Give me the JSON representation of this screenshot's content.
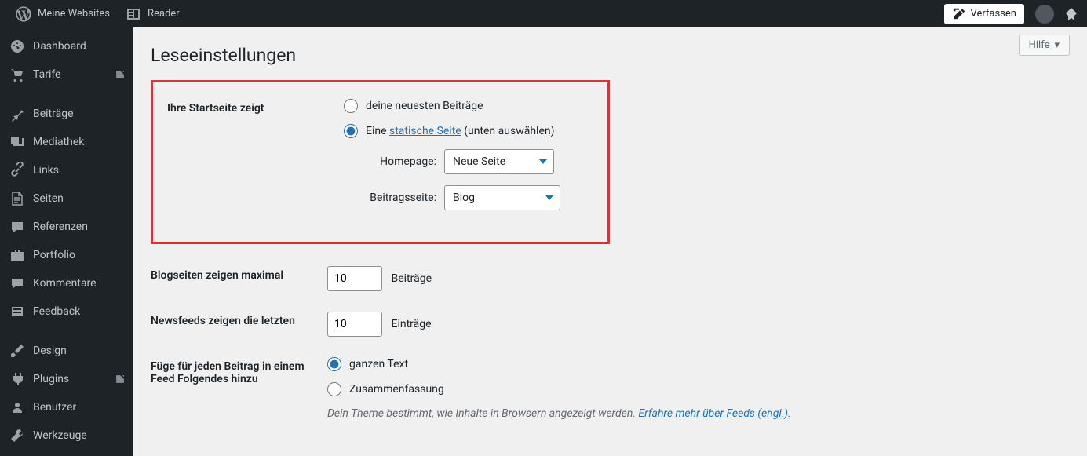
{
  "topbar": {
    "my_sites": "Meine Websites",
    "reader": "Reader",
    "compose": "Verfassen"
  },
  "sidebar": {
    "items": [
      {
        "label": "Dashboard",
        "icon": "dashboard"
      },
      {
        "label": "Tarife",
        "icon": "cart",
        "ext": true
      },
      {
        "label": "Beiträge",
        "icon": "pin"
      },
      {
        "label": "Mediathek",
        "icon": "media"
      },
      {
        "label": "Links",
        "icon": "link"
      },
      {
        "label": "Seiten",
        "icon": "page"
      },
      {
        "label": "Referenzen",
        "icon": "quote"
      },
      {
        "label": "Portfolio",
        "icon": "portfolio"
      },
      {
        "label": "Kommentare",
        "icon": "comment"
      },
      {
        "label": "Feedback",
        "icon": "feedback"
      },
      {
        "label": "Design",
        "icon": "brush"
      },
      {
        "label": "Plugins",
        "icon": "plugin",
        "ext": true
      },
      {
        "label": "Benutzer",
        "icon": "user"
      },
      {
        "label": "Werkzeuge",
        "icon": "tool"
      }
    ]
  },
  "help_tab": "Hilfe",
  "page_title": "Leseeinstellungen",
  "rows": {
    "front": {
      "label": "Ihre Startseite zeigt",
      "opt_latest": "deine neuesten Beiträge",
      "opt_static_pre": "Eine ",
      "opt_static_link": "statische Seite",
      "opt_static_post": " (unten auswählen)",
      "homepage_label": "Homepage:",
      "homepage_value": "Neue Seite",
      "posts_label": "Beitragsseite:",
      "posts_value": "Blog"
    },
    "blog_max": {
      "label": "Blogseiten zeigen maximal",
      "value": "10",
      "suffix": "Beiträge"
    },
    "feed_max": {
      "label": "Newsfeeds zeigen die letzten",
      "value": "10",
      "suffix": "Einträge"
    },
    "feed_content": {
      "label": "Füge für jeden Beitrag in einem Feed Folgendes hinzu",
      "opt_full": "ganzen Text",
      "opt_summary": "Zusammenfassung",
      "desc_pre": "Dein Theme bestimmt, wie Inhalte in Browsern angezeigt werden. ",
      "desc_link": "Erfahre mehr über Feeds (engl.)",
      "desc_post": "."
    }
  }
}
